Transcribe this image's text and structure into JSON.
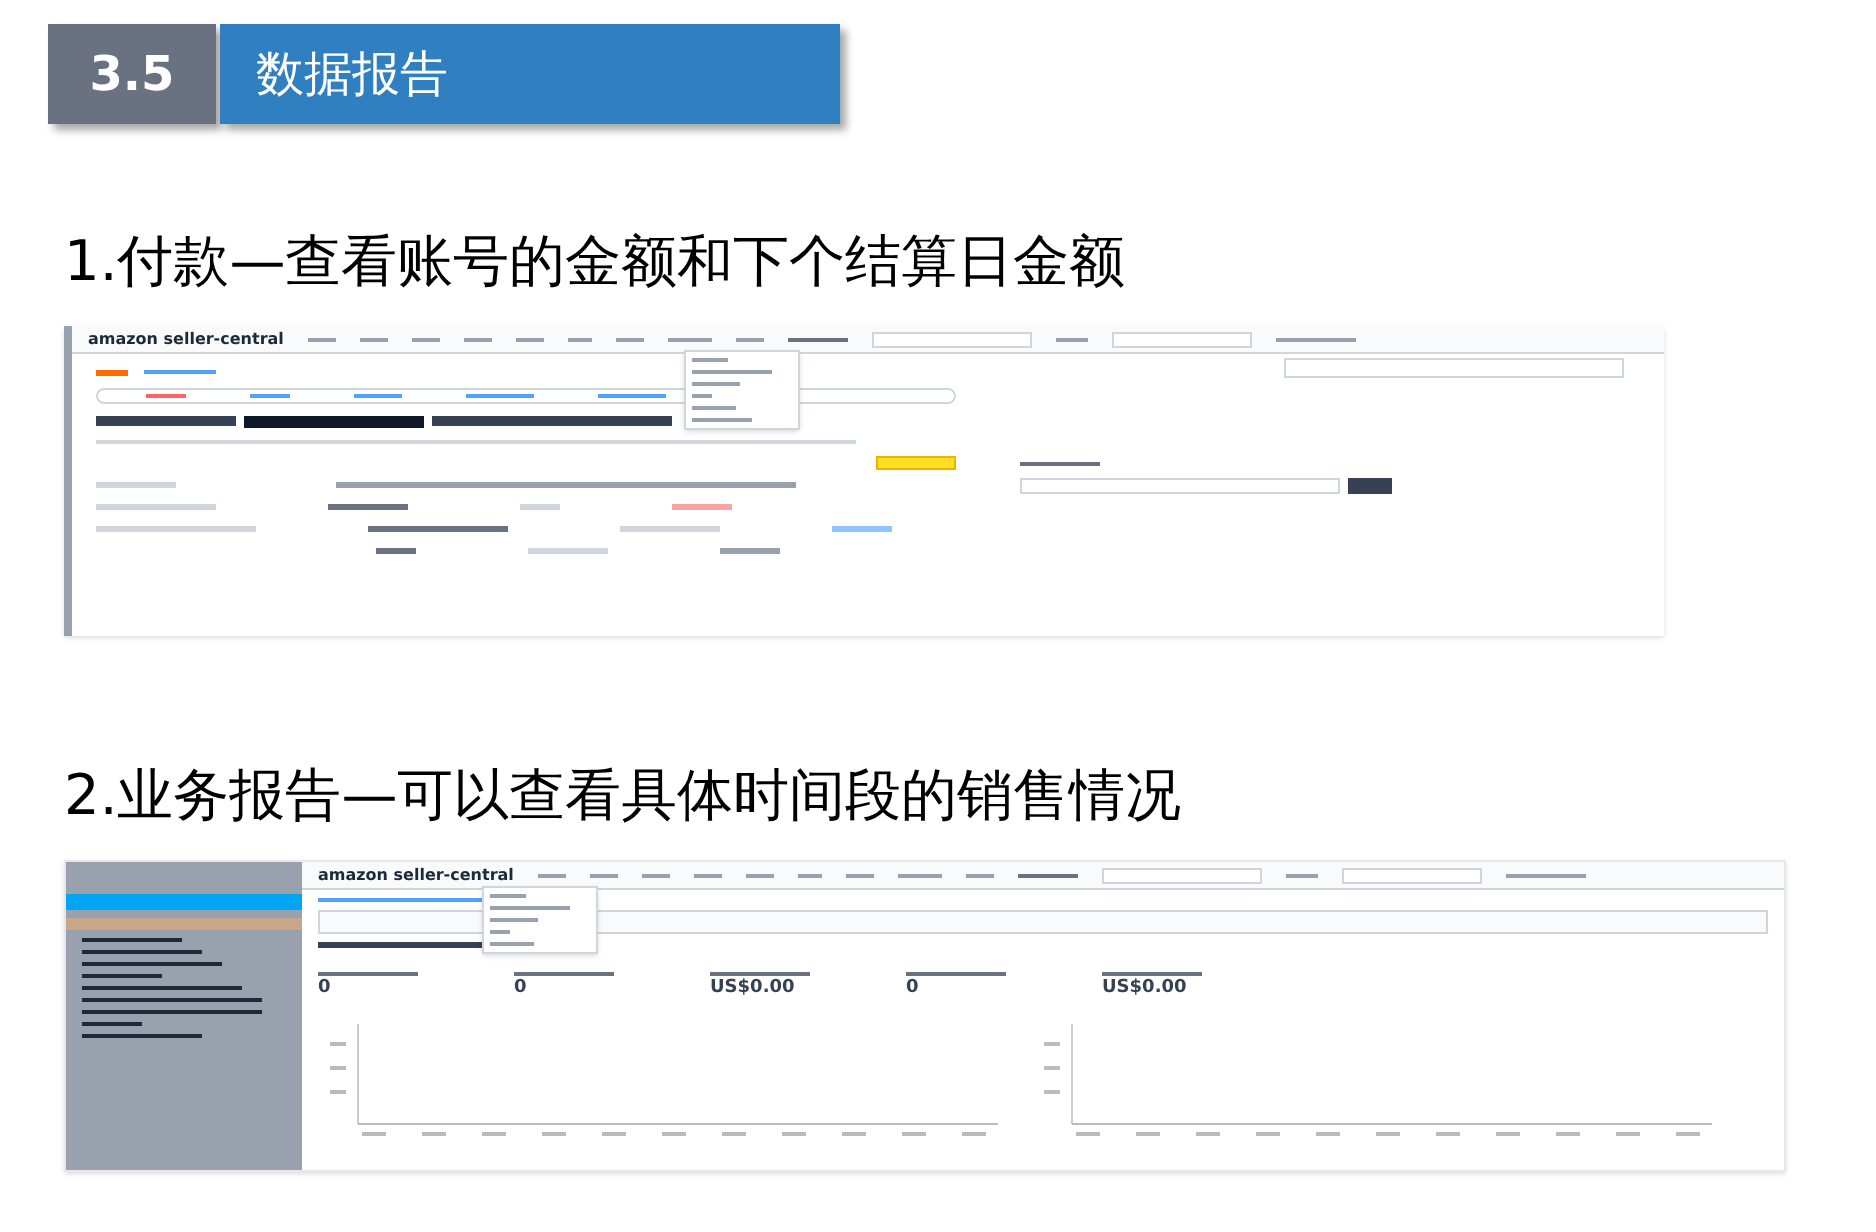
{
  "header": {
    "number": "3.5",
    "title": "数据报告"
  },
  "sections": [
    {
      "heading": "1.付款—查看账号的金额和下个结算日金额",
      "screenshot": {
        "kind": "payments",
        "logo": "amazon seller-central"
      }
    },
    {
      "heading": "2.业务报告—可以查看具体时间段的销售情况",
      "screenshot": {
        "kind": "business",
        "logo": "amazon seller-central",
        "metrics": [
          "0",
          "0",
          "US$0.00",
          "0",
          "US$0.00"
        ]
      }
    }
  ]
}
